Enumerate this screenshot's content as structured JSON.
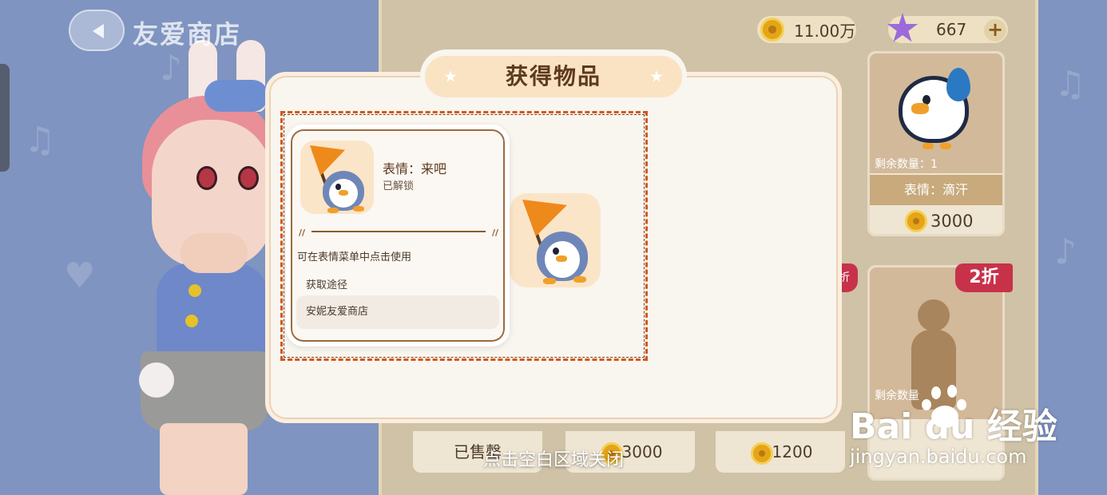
{
  "header": {
    "shop_title": "友爱商店"
  },
  "currencies": {
    "coins": "11.00万",
    "stars": "667",
    "add_label": "+"
  },
  "shop_cards": {
    "top_right": {
      "remaining": "剩余数量：1",
      "label": "表情：滴汗",
      "price": "3000"
    },
    "middle_right": {
      "discount": "2折",
      "discount_partial": "折",
      "remaining": "剩余数量"
    },
    "bottom": [
      {
        "text": "已售罄"
      },
      {
        "price": "3000"
      },
      {
        "price": "1200"
      }
    ]
  },
  "modal": {
    "title": "获得物品",
    "item": {
      "name": "表情：来吧",
      "status": "已解锁",
      "usage": "可在表情菜单中点击使用",
      "source_label": "获取途径",
      "source": "安妮友爱商店"
    }
  },
  "close_hint": "点击空白区域关闭",
  "watermark": {
    "brand": "Bai  du 经验",
    "url": "jingyan.baidu.com"
  },
  "colors": {
    "modal_bg": "#f9f5ef",
    "title_pill": "#fae3c2",
    "highlight_border": "#d05a1a",
    "discount": "#c7324a",
    "coin": "#e4a51a"
  },
  "icons": {
    "back": "chevron-left-icon",
    "coin": "coin-icon",
    "star": "star-icon",
    "item": "penguin-flag-emote-icon"
  }
}
